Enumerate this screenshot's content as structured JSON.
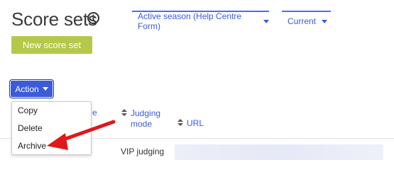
{
  "header": {
    "title": "Score sets",
    "info_icon": "info-circle-icon"
  },
  "filters": {
    "season": "Active season (Help Centre Form)",
    "status": "Current"
  },
  "toolbar": {
    "new_label": "New score set",
    "action_label": "Action"
  },
  "action_menu": {
    "items": [
      "Copy",
      "Delete",
      "Archive"
    ]
  },
  "table": {
    "partial_header": "e",
    "columns": [
      {
        "label_line1": "Judging",
        "label_line2": "mode"
      },
      {
        "label_line1": "URL"
      }
    ],
    "rows": [
      {
        "judging_mode": "VIP judging"
      }
    ]
  },
  "annotation": {
    "arrow_color": "#e0181b",
    "points_to": "Archive"
  },
  "colors": {
    "accent": "#3b5bdb",
    "new_button": "#b5c84a"
  }
}
